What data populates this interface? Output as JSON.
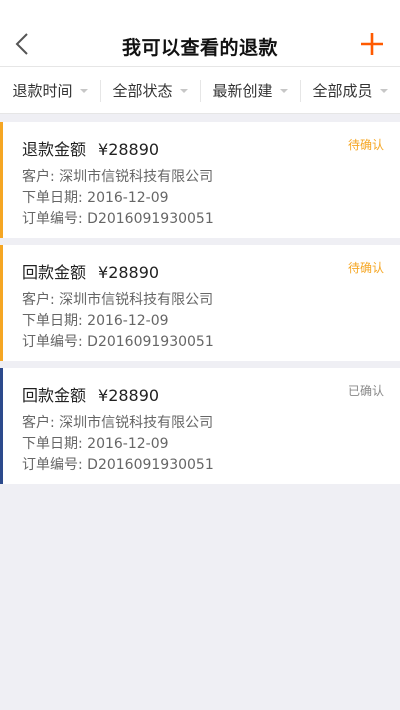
{
  "header": {
    "title": "我可以查看的退款"
  },
  "filters": [
    {
      "label": "退款时间"
    },
    {
      "label": "全部状态"
    },
    {
      "label": "最新创建"
    },
    {
      "label": "全部成员"
    }
  ],
  "records": [
    {
      "type_label": "退款金额",
      "amount": "¥28890",
      "status": "待确认",
      "customer": "客户: 深圳市信锐科技有限公司",
      "order_date": "下单日期: 2016-12-09",
      "order_no": "订单编号: D2016091930051"
    },
    {
      "type_label": "回款金额",
      "amount": "¥28890",
      "status": "待确认",
      "customer": "客户: 深圳市信锐科技有限公司",
      "order_date": "下单日期: 2016-12-09",
      "order_no": "订单编号: D2016091930051"
    },
    {
      "type_label": "回款金额",
      "amount": "¥28890",
      "status": "已确认",
      "customer": "客户: 深圳市信锐科技有限公司",
      "order_date": "下单日期: 2016-12-09",
      "order_no": "订单编号: D2016091930051"
    }
  ],
  "colors": {
    "accent": "#f5a623",
    "add_icon": "#ff5a00",
    "confirmed_bar": "#2c4a8c",
    "background": "#efeff4"
  },
  "icons": {
    "back": "chevron-left-icon",
    "add": "plus-icon",
    "dropdown": "caret-down-icon"
  }
}
